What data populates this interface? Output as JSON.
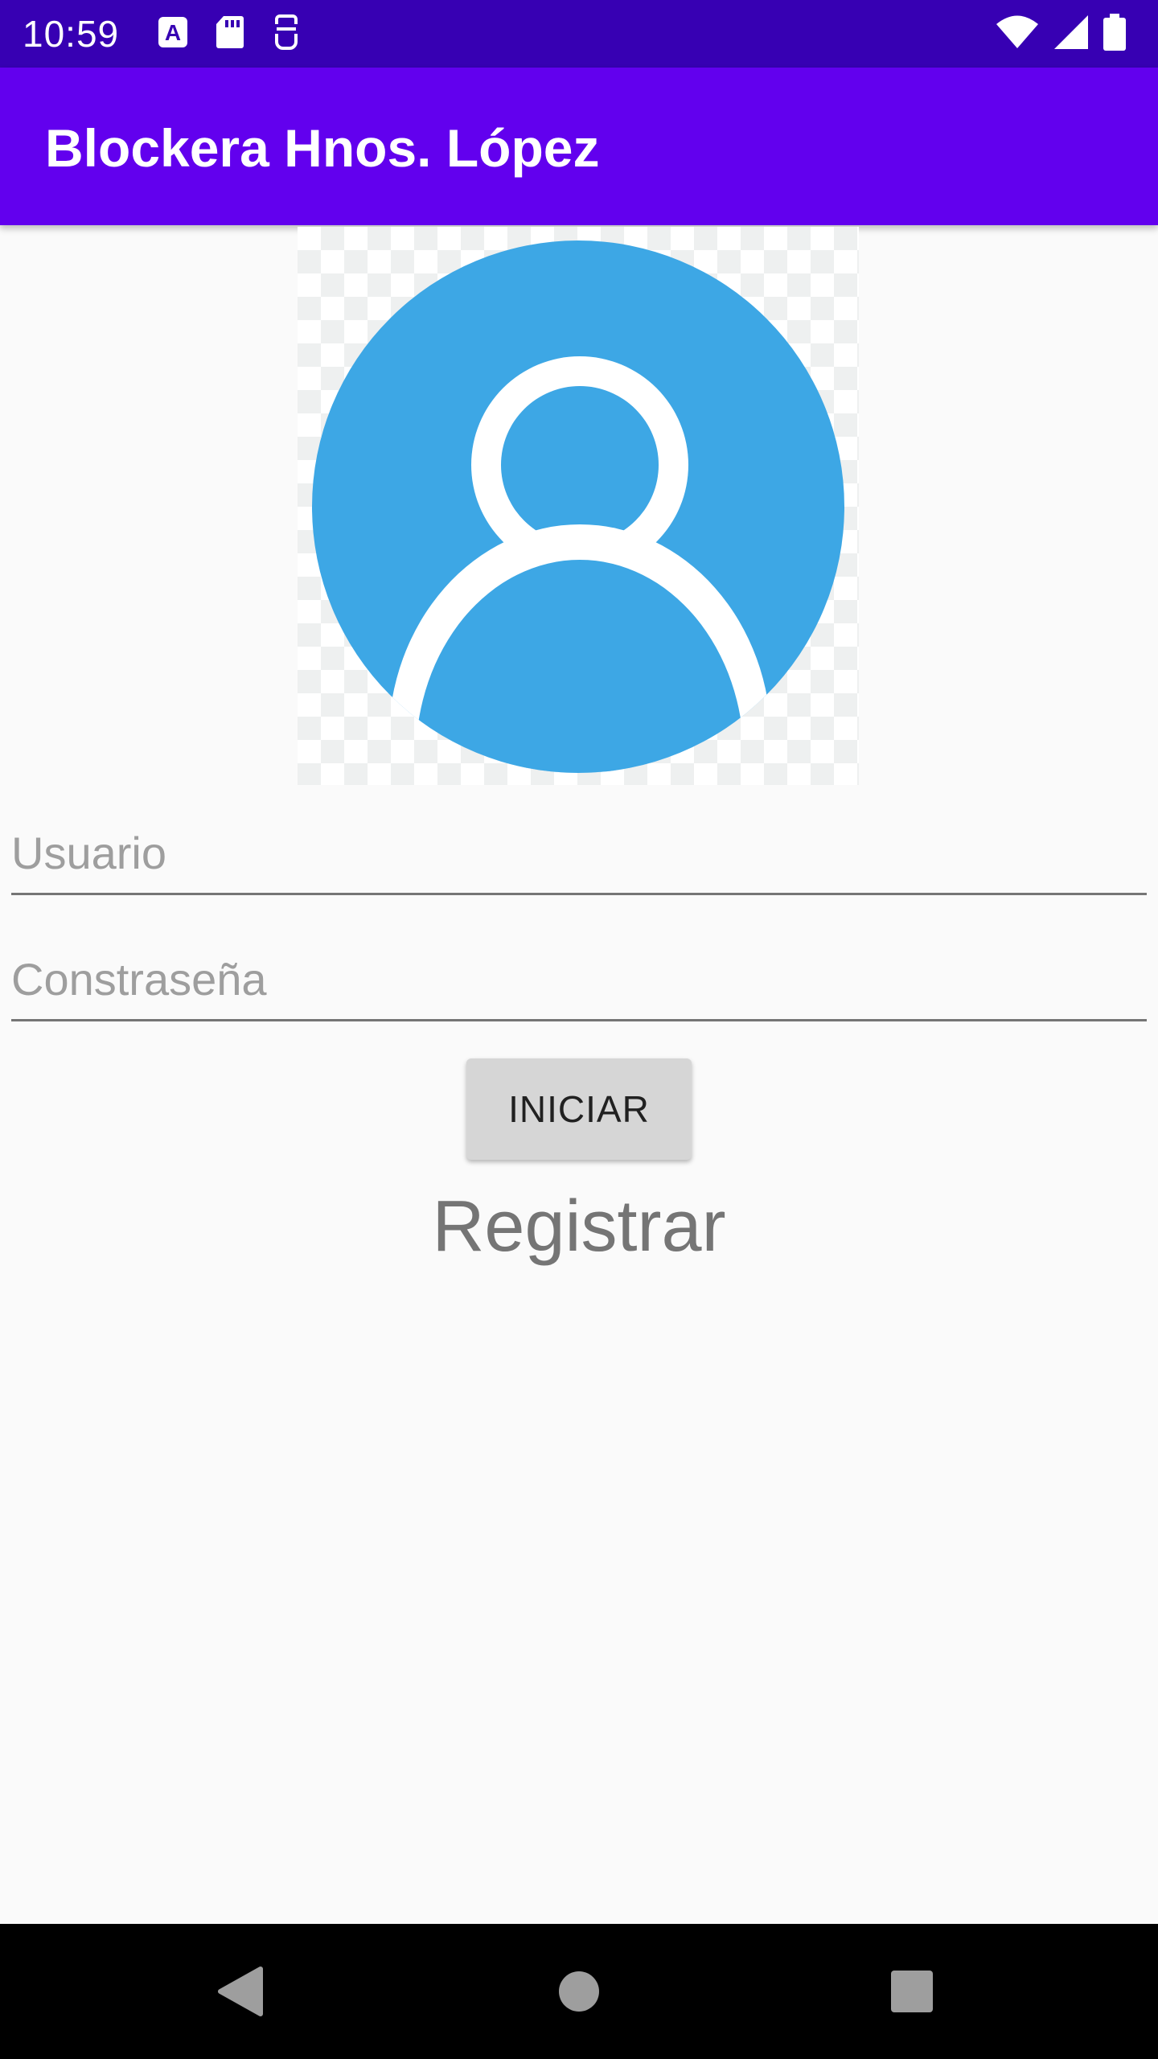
{
  "status_bar": {
    "time": "10:59",
    "left_icons": [
      "a-notification-icon",
      "sd-card-icon",
      "face-id-icon"
    ],
    "right_icons": [
      "wifi-icon",
      "signal-icon",
      "battery-icon"
    ]
  },
  "app_bar": {
    "title": "Blockera Hnos. López",
    "color": "#6200EE"
  },
  "avatar": {
    "icon": "user-avatar-icon",
    "color": "#3DA7E5"
  },
  "form": {
    "username_placeholder": "Usuario",
    "username_value": "",
    "password_placeholder": "Constraseña",
    "password_value": "",
    "login_label": "INICIAR",
    "register_label": "Registrar"
  },
  "nav_bar": {
    "icons": [
      "back-icon",
      "home-icon",
      "recents-icon"
    ]
  },
  "colors": {
    "status_bar": "#3700B3",
    "background": "#FAFAFA",
    "button": "#D6D6D6"
  }
}
